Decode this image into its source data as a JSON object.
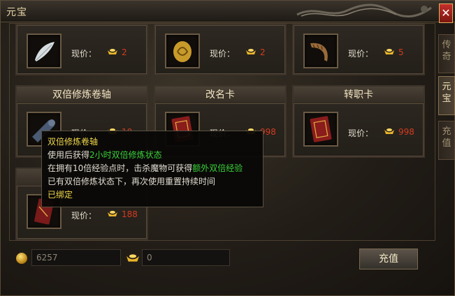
{
  "window": {
    "title": "元宝",
    "close_symbol": "✕"
  },
  "tabs": [
    {
      "label": "传\n奇",
      "active": false
    },
    {
      "label": "元\n宝",
      "active": true
    },
    {
      "label": "充\n值",
      "active": false
    }
  ],
  "price_label": "现价：",
  "items": [
    {
      "name": "",
      "icon": "white-feather-icon",
      "price": "2"
    },
    {
      "name": "",
      "icon": "golden-token-icon",
      "price": "2"
    },
    {
      "name": "",
      "icon": "horn-icon",
      "price": "5"
    },
    {
      "name": "双倍修炼卷轴",
      "icon": "scroll-icon",
      "price": "10"
    },
    {
      "name": "改名卡",
      "icon": "red-book-icon",
      "price": "998"
    },
    {
      "name": "转职卡",
      "icon": "red-book-icon",
      "price": "998"
    },
    {
      "name": "",
      "icon": "red-scroll-icon",
      "price": "188"
    }
  ],
  "tooltip": {
    "title": "双倍修炼卷轴",
    "line1_a": "使用后获得",
    "line1_b": "2小时双倍修炼状态",
    "line2_a": "在拥有10倍经验点时，击杀魔物可获得",
    "line2_b": "额外双倍经验",
    "line3": "已有双倍修炼状态下，再次使用重置持续时间",
    "line4": "已绑定"
  },
  "footer": {
    "gold_value": "6257",
    "ingot_value": "0",
    "recharge_label": "充值"
  },
  "colors": {
    "price": "#d33b20",
    "highlight_green": "#3ad23a",
    "title_yellow": "#f0d84a"
  }
}
